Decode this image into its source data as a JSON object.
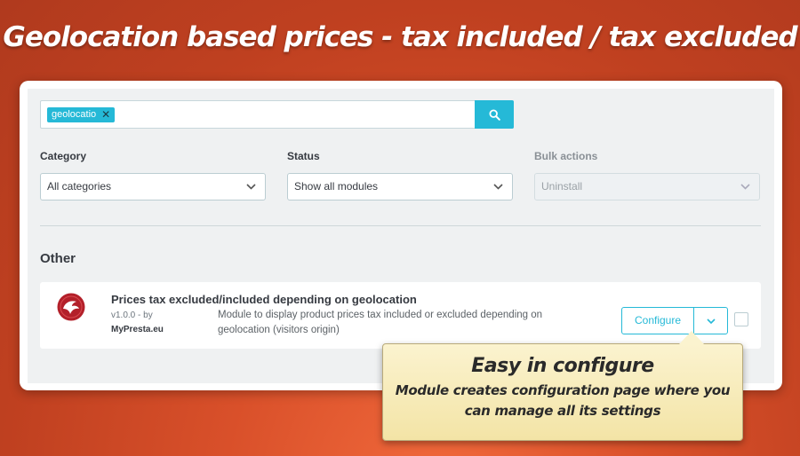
{
  "banner": {
    "title": "Geolocation based prices - tax included / tax excluded"
  },
  "search": {
    "tag": "geolocatio",
    "tag_remove": "✕",
    "icon": "search-icon"
  },
  "filters": {
    "category_label": "Category",
    "category_value": "All categories",
    "status_label": "Status",
    "status_value": "Show all modules",
    "bulk_label": "Bulk actions",
    "bulk_value": "Uninstall"
  },
  "section": {
    "title": "Other"
  },
  "module": {
    "name": "Prices tax excluded/included depending on geolocation",
    "version": "v1.0.0 - by",
    "author": "MyPresta.eu",
    "description": "Module to display product prices tax included or excluded depending on geolocation (visitors origin)",
    "configure_label": "Configure",
    "logo_icon": "mypresta-logo-icon"
  },
  "callout": {
    "title": "Easy in configure",
    "text": "Module creates configuration page where you can manage all its settings"
  },
  "colors": {
    "accent": "#25b9d7",
    "brand_red": "#b3202a",
    "background": "#d9502a"
  }
}
